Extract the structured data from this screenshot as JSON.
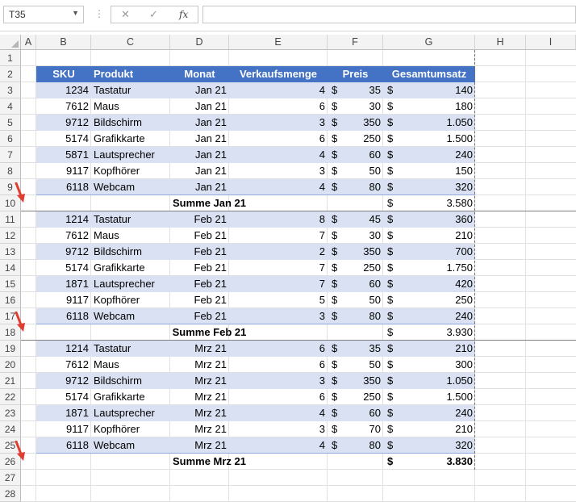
{
  "formula_bar": {
    "name_box": "T35",
    "fx_label": "fx",
    "formula": ""
  },
  "columns": [
    "A",
    "B",
    "C",
    "D",
    "E",
    "F",
    "G",
    "H",
    "I"
  ],
  "header": {
    "sku": "SKU",
    "produkt": "Produkt",
    "monat": "Monat",
    "menge": "Verkaufsmenge",
    "preis": "Preis",
    "umsatz": "Gesamtumsatz"
  },
  "currency": "$",
  "colors": {
    "header_fill": "#4472c4",
    "band_fill": "#d9e1f2",
    "arrow": "#e03c31"
  },
  "rows": [
    {
      "row": "1",
      "type": "empty"
    },
    {
      "row": "2",
      "type": "header"
    },
    {
      "row": "3",
      "type": "data",
      "band": "light",
      "sku": "1234",
      "produkt": "Tastatur",
      "monat": "Jan 21",
      "menge": "4",
      "preis": "35",
      "umsatz": "140"
    },
    {
      "row": "4",
      "type": "data",
      "band": "white",
      "sku": "7612",
      "produkt": "Maus",
      "monat": "Jan 21",
      "menge": "6",
      "preis": "30",
      "umsatz": "180"
    },
    {
      "row": "5",
      "type": "data",
      "band": "light",
      "sku": "9712",
      "produkt": "Bildschirm",
      "monat": "Jan 21",
      "menge": "3",
      "preis": "350",
      "umsatz": "1.050"
    },
    {
      "row": "6",
      "type": "data",
      "band": "white",
      "sku": "5174",
      "produkt": "Grafikkarte",
      "monat": "Jan 21",
      "menge": "6",
      "preis": "250",
      "umsatz": "1.500"
    },
    {
      "row": "7",
      "type": "data",
      "band": "light",
      "sku": "5871",
      "produkt": "Lautsprecher",
      "monat": "Jan 21",
      "menge": "4",
      "preis": "60",
      "umsatz": "240"
    },
    {
      "row": "8",
      "type": "data",
      "band": "white",
      "sku": "9117",
      "produkt": "Kopfhörer",
      "monat": "Jan 21",
      "menge": "3",
      "preis": "50",
      "umsatz": "150"
    },
    {
      "row": "9",
      "type": "data",
      "band": "light",
      "sku": "6118",
      "produkt": "Webcam",
      "monat": "Jan 21",
      "menge": "4",
      "preis": "80",
      "umsatz": "320"
    },
    {
      "row": "10",
      "type": "subtotal",
      "label": "Summe Jan 21",
      "umsatz": "3.580",
      "arrow": true
    },
    {
      "row": "11",
      "type": "data",
      "band": "light",
      "sku": "1214",
      "produkt": "Tastatur",
      "monat": "Feb 21",
      "menge": "8",
      "preis": "45",
      "umsatz": "360"
    },
    {
      "row": "12",
      "type": "data",
      "band": "white",
      "sku": "7612",
      "produkt": "Maus",
      "monat": "Feb 21",
      "menge": "7",
      "preis": "30",
      "umsatz": "210"
    },
    {
      "row": "13",
      "type": "data",
      "band": "light",
      "sku": "9712",
      "produkt": "Bildschirm",
      "monat": "Feb 21",
      "menge": "2",
      "preis": "350",
      "umsatz": "700"
    },
    {
      "row": "14",
      "type": "data",
      "band": "white",
      "sku": "5174",
      "produkt": "Grafikkarte",
      "monat": "Feb 21",
      "menge": "7",
      "preis": "250",
      "umsatz": "1.750"
    },
    {
      "row": "15",
      "type": "data",
      "band": "light",
      "sku": "1871",
      "produkt": "Lautsprecher",
      "monat": "Feb 21",
      "menge": "7",
      "preis": "60",
      "umsatz": "420"
    },
    {
      "row": "16",
      "type": "data",
      "band": "white",
      "sku": "9117",
      "produkt": "Kopfhörer",
      "monat": "Feb 21",
      "menge": "5",
      "preis": "50",
      "umsatz": "250"
    },
    {
      "row": "17",
      "type": "data",
      "band": "light",
      "sku": "6118",
      "produkt": "Webcam",
      "monat": "Feb 21",
      "menge": "3",
      "preis": "80",
      "umsatz": "240"
    },
    {
      "row": "18",
      "type": "subtotal",
      "label": "Summe Feb 21",
      "umsatz": "3.930",
      "arrow": true
    },
    {
      "row": "19",
      "type": "data",
      "band": "light",
      "sku": "1214",
      "produkt": "Tastatur",
      "monat": "Mrz 21",
      "menge": "6",
      "preis": "35",
      "umsatz": "210"
    },
    {
      "row": "20",
      "type": "data",
      "band": "white",
      "sku": "7612",
      "produkt": "Maus",
      "monat": "Mrz 21",
      "menge": "6",
      "preis": "50",
      "umsatz": "300"
    },
    {
      "row": "21",
      "type": "data",
      "band": "light",
      "sku": "9712",
      "produkt": "Bildschirm",
      "monat": "Mrz 21",
      "menge": "3",
      "preis": "350",
      "umsatz": "1.050"
    },
    {
      "row": "22",
      "type": "data",
      "band": "white",
      "sku": "5174",
      "produkt": "Grafikkarte",
      "monat": "Mrz 21",
      "menge": "6",
      "preis": "250",
      "umsatz": "1.500"
    },
    {
      "row": "23",
      "type": "data",
      "band": "light",
      "sku": "1871",
      "produkt": "Lautsprecher",
      "monat": "Mrz 21",
      "menge": "4",
      "preis": "60",
      "umsatz": "240"
    },
    {
      "row": "24",
      "type": "data",
      "band": "white",
      "sku": "9117",
      "produkt": "Kopfhörer",
      "monat": "Mrz 21",
      "menge": "3",
      "preis": "70",
      "umsatz": "210"
    },
    {
      "row": "25",
      "type": "data",
      "band": "light",
      "sku": "6118",
      "produkt": "Webcam",
      "monat": "Mrz 21",
      "menge": "4",
      "preis": "80",
      "umsatz": "320"
    },
    {
      "row": "26",
      "type": "subtotal",
      "label": "Summe Mrz 21",
      "umsatz": "3.830",
      "arrow": true,
      "bold_total": true
    },
    {
      "row": "27",
      "type": "empty"
    },
    {
      "row": "28",
      "type": "empty"
    }
  ]
}
